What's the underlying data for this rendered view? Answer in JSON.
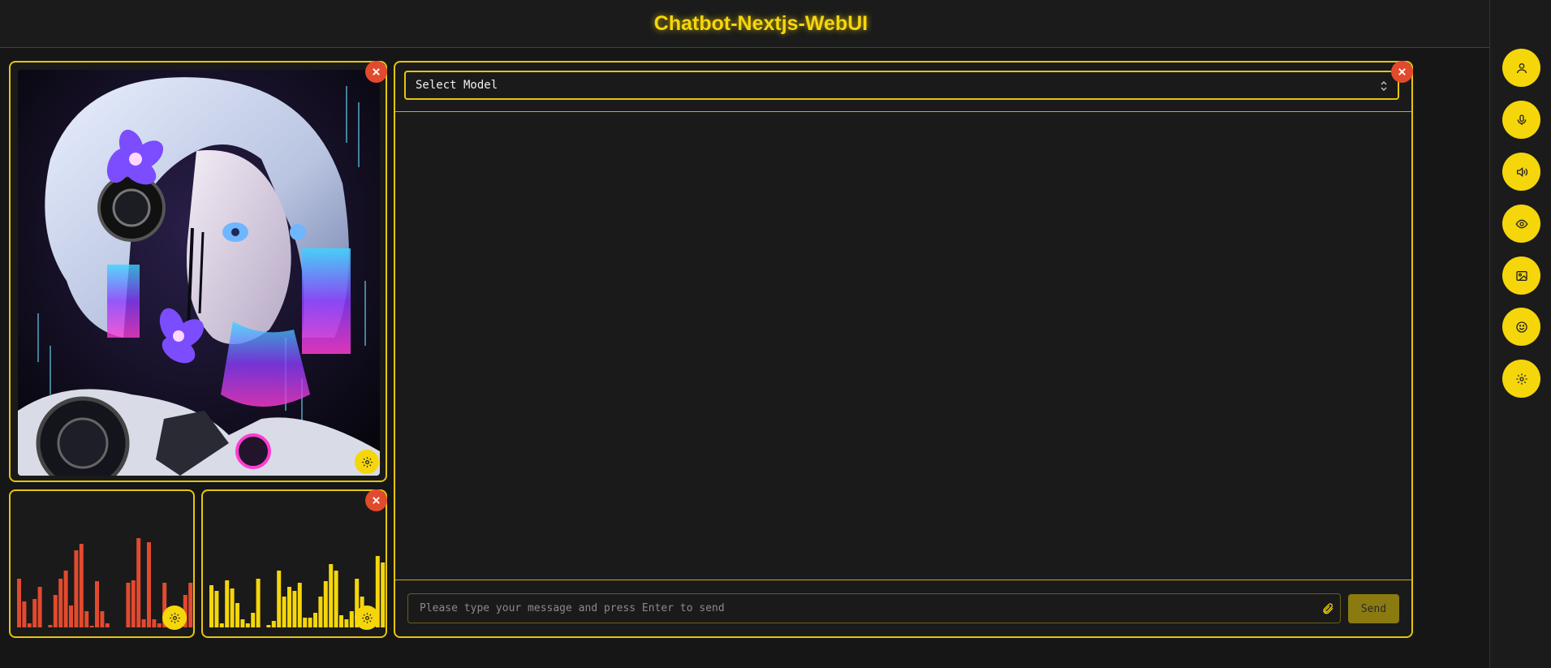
{
  "header": {
    "title": "Chatbot-Nextjs-WebUI"
  },
  "rightbar": {
    "buttons": [
      {
        "name": "user-icon"
      },
      {
        "name": "microphone-icon"
      },
      {
        "name": "speaker-icon"
      },
      {
        "name": "eye-icon"
      },
      {
        "name": "image-icon"
      },
      {
        "name": "smile-icon"
      },
      {
        "name": "settings-icon"
      }
    ]
  },
  "chat": {
    "model_select": {
      "value": "Select Model"
    },
    "input": {
      "placeholder": "Please type your message and press Enter to send",
      "value": ""
    },
    "send_label": "Send"
  },
  "visualizers": {
    "left": {
      "color": "#e24a2e"
    },
    "right": {
      "color": "#f5d60a"
    }
  },
  "colors": {
    "accent": "#f5d60a",
    "danger": "#e24a2e",
    "background": "#161616"
  }
}
